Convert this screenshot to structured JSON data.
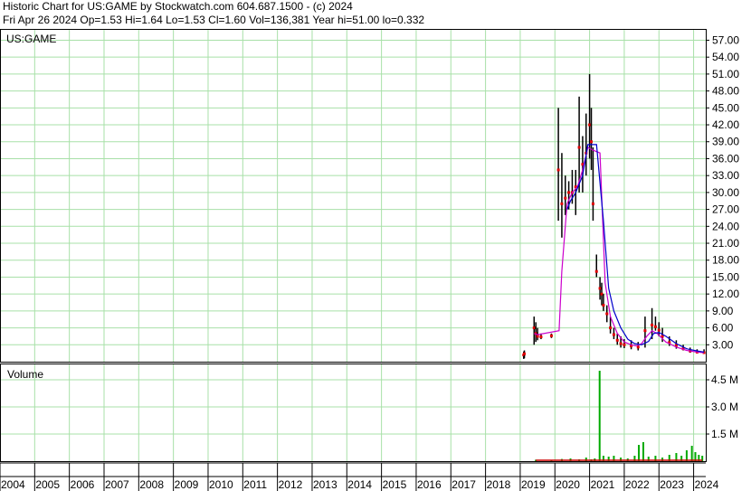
{
  "header": {
    "line1": "Historic Chart for US:GAME by Stockwatch.com 604.687.1500 - (c) 2024",
    "line2": "Fri Apr 26 2024   Op=1.53  Hi=1.64  Lo=1.53  Cl=1.60  Vol=136,381  Year hi=51.00  lo=0.332"
  },
  "price_panel": {
    "symbol": "US:GAME"
  },
  "volume_panel": {
    "title": "Volume"
  },
  "colors": {
    "grid": "#a8e0a8",
    "price_bar": "#000000",
    "close_mark": "#e00000",
    "ma_short": "#cc00cc",
    "ma_long": "#0000cc",
    "volume": "#00aa00",
    "volume_red": "#cc0000"
  },
  "chart_data": {
    "type": "line",
    "price_axis": {
      "ticks": [
        "57.00",
        "54.00",
        "51.00",
        "48.00",
        "45.00",
        "42.00",
        "39.00",
        "36.00",
        "33.00",
        "30.00",
        "27.00",
        "24.00",
        "21.00",
        "18.00",
        "15.00",
        "12.00",
        "9.00",
        "6.00",
        "3.00"
      ],
      "ylim": [
        0,
        59
      ]
    },
    "volume_axis": {
      "ticks": [
        "4.5 M",
        "3.0 M",
        "1.5 M"
      ],
      "tick_values": [
        4.5,
        3.0,
        1.5
      ],
      "ylim": [
        0,
        5.4
      ]
    },
    "x_axis": {
      "ticks": [
        "2004",
        "2005",
        "2006",
        "2007",
        "2008",
        "2009",
        "2010",
        "2011",
        "2012",
        "2013",
        "2014",
        "2015",
        "2016",
        "2017",
        "2018",
        "2019",
        "2020",
        "2021",
        "2022",
        "2023",
        "2024"
      ],
      "range": [
        2004.0,
        2024.35
      ]
    },
    "grid": true,
    "series": [
      {
        "name": "",
        "kind": "price",
        "x": [
          2019.1,
          2019.12,
          2019.4,
          2019.45,
          2019.5,
          2019.6,
          2019.9,
          2020.1,
          2020.2,
          2020.3,
          2020.4,
          2020.5,
          2020.6,
          2020.7,
          2020.8,
          2020.9,
          2021.0,
          2021.05,
          2021.1,
          2021.2,
          2021.3,
          2021.35,
          2021.4,
          2021.5,
          2021.6,
          2021.7,
          2021.8,
          2021.9,
          2022.0,
          2022.2,
          2022.4,
          2022.6,
          2022.8,
          2022.9,
          2023.0,
          2023.1,
          2023.3,
          2023.5,
          2023.7,
          2023.9,
          2024.1,
          2024.3
        ],
        "low": [
          0.5,
          0.6,
          3.0,
          3.5,
          3.8,
          4.0,
          4.2,
          25.0,
          22.0,
          26.0,
          27.0,
          28.0,
          26.0,
          30.0,
          30.0,
          33.0,
          36.0,
          34.0,
          25.0,
          15.0,
          11.0,
          10.0,
          9.0,
          7.0,
          5.0,
          4.0,
          3.0,
          2.5,
          2.4,
          2.2,
          2.0,
          2.5,
          4.0,
          5.5,
          4.5,
          3.5,
          2.8,
          2.3,
          2.0,
          1.6,
          1.5,
          1.5
        ],
        "high": [
          1.8,
          2.0,
          8.0,
          7.0,
          6.0,
          5.0,
          5.0,
          45.0,
          37.0,
          33.0,
          32.0,
          34.0,
          34.0,
          47.0,
          40.0,
          44.0,
          51.0,
          45.0,
          38.0,
          19.0,
          15.0,
          14.0,
          12.0,
          10.0,
          8.0,
          6.0,
          5.0,
          4.5,
          4.0,
          3.8,
          3.5,
          8.0,
          9.5,
          8.0,
          7.0,
          6.0,
          4.5,
          3.8,
          3.0,
          2.5,
          2.2,
          2.2
        ],
        "close": [
          1.2,
          1.4,
          6.0,
          5.0,
          4.5,
          4.4,
          4.6,
          34.0,
          28.0,
          29.0,
          30.0,
          30.0,
          31.0,
          38.0,
          35.0,
          37.0,
          42.0,
          39.0,
          28.0,
          16.0,
          13.0,
          12.0,
          10.0,
          8.5,
          6.0,
          4.8,
          3.8,
          3.2,
          3.0,
          2.8,
          2.6,
          5.5,
          6.5,
          6.2,
          5.6,
          4.5,
          3.4,
          2.9,
          2.3,
          1.9,
          1.7,
          1.6
        ]
      },
      {
        "name": "",
        "kind": "ma_short",
        "x": [
          2019.4,
          2019.5,
          2020.12,
          2020.2,
          2020.35,
          2020.5,
          2020.65,
          2020.8,
          2020.95,
          2021.1,
          2021.3,
          2021.45,
          2021.6,
          2021.8,
          2022.0,
          2022.2,
          2022.35,
          2022.5,
          2022.65,
          2022.8,
          2022.95,
          2023.2,
          2023.5,
          2023.8,
          2024.1,
          2024.3
        ],
        "values": [
          5.0,
          4.8,
          5.5,
          16.0,
          28.0,
          30.0,
          31.0,
          34.0,
          38.0,
          37.5,
          37.0,
          14.0,
          8.0,
          5.0,
          3.5,
          3.0,
          2.8,
          3.2,
          4.5,
          5.5,
          5.0,
          3.5,
          2.6,
          2.0,
          1.7,
          1.6
        ]
      },
      {
        "name": "",
        "kind": "ma_long",
        "x": [
          2020.35,
          2020.45,
          2020.6,
          2020.8,
          2020.95,
          2021.2,
          2021.4,
          2021.55,
          2021.7,
          2021.9,
          2022.1,
          2022.3,
          2022.5,
          2022.7,
          2022.85,
          2023.0,
          2023.2,
          2023.5,
          2023.8,
          2024.1,
          2024.3
        ],
        "values": [
          27.0,
          28.5,
          30.0,
          33.0,
          38.5,
          38.5,
          25.0,
          13.0,
          9.0,
          6.0,
          4.0,
          3.2,
          3.0,
          3.6,
          5.0,
          5.2,
          4.5,
          3.2,
          2.3,
          1.9,
          1.7
        ]
      },
      {
        "name": "Volume",
        "kind": "volume",
        "x": [
          2019.45,
          2019.9,
          2020.2,
          2020.45,
          2020.7,
          2020.9,
          2021.05,
          2021.15,
          2021.29,
          2021.4,
          2021.55,
          2021.7,
          2021.9,
          2022.1,
          2022.3,
          2022.42,
          2022.55,
          2022.7,
          2022.9,
          2023.1,
          2023.3,
          2023.5,
          2023.65,
          2023.8,
          2023.95,
          2024.05,
          2024.15,
          2024.25
        ],
        "values": [
          0.08,
          0.05,
          0.12,
          0.15,
          0.1,
          0.2,
          0.1,
          0.15,
          5.0,
          0.3,
          0.25,
          0.3,
          0.2,
          0.15,
          0.3,
          0.9,
          1.05,
          0.25,
          0.3,
          0.2,
          0.35,
          0.45,
          0.3,
          0.6,
          0.85,
          0.5,
          0.35,
          0.3
        ]
      }
    ]
  }
}
